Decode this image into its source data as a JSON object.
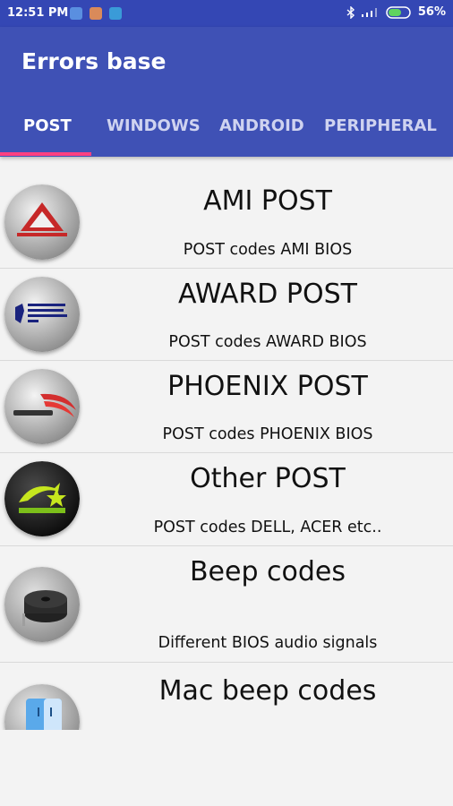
{
  "status": {
    "time": "12:51 PM",
    "battery": "56%",
    "icons": [
      "notification-icon-blue",
      "notification-icon-orange",
      "notification-icon-teal",
      "bluetooth-icon",
      "signal-icon",
      "battery-icon"
    ],
    "colors": {
      "bar": "#3447b4"
    }
  },
  "appbar": {
    "title": "Errors base",
    "tabs": [
      {
        "label": "POST",
        "active": true
      },
      {
        "label": "WINDOWS",
        "active": false
      },
      {
        "label": "ANDROID",
        "active": false
      },
      {
        "label": "PERIPHERAL",
        "active": false
      }
    ],
    "colors": {
      "primary": "#3f51b5",
      "indicator": "#ff4081"
    }
  },
  "items": [
    {
      "title": "AMI POST",
      "subtitle": "POST codes AMI BIOS",
      "icon": "ami-logo-icon"
    },
    {
      "title": "AWARD POST",
      "subtitle": "POST codes AWARD BIOS",
      "icon": "award-logo-icon"
    },
    {
      "title": "PHOENIX POST",
      "subtitle": "POST codes  PHOENIX BIOS",
      "icon": "phoenix-logo-icon"
    },
    {
      "title": "Other POST",
      "subtitle": "POST codes DELL, ACER etc..",
      "icon": "energy-star-logo-icon"
    },
    {
      "title": "Beep codes",
      "subtitle": "Different BIOS audio signals",
      "icon": "buzzer-icon"
    },
    {
      "title": "Mac beep codes",
      "subtitle": "",
      "icon": "mac-finder-icon"
    }
  ]
}
